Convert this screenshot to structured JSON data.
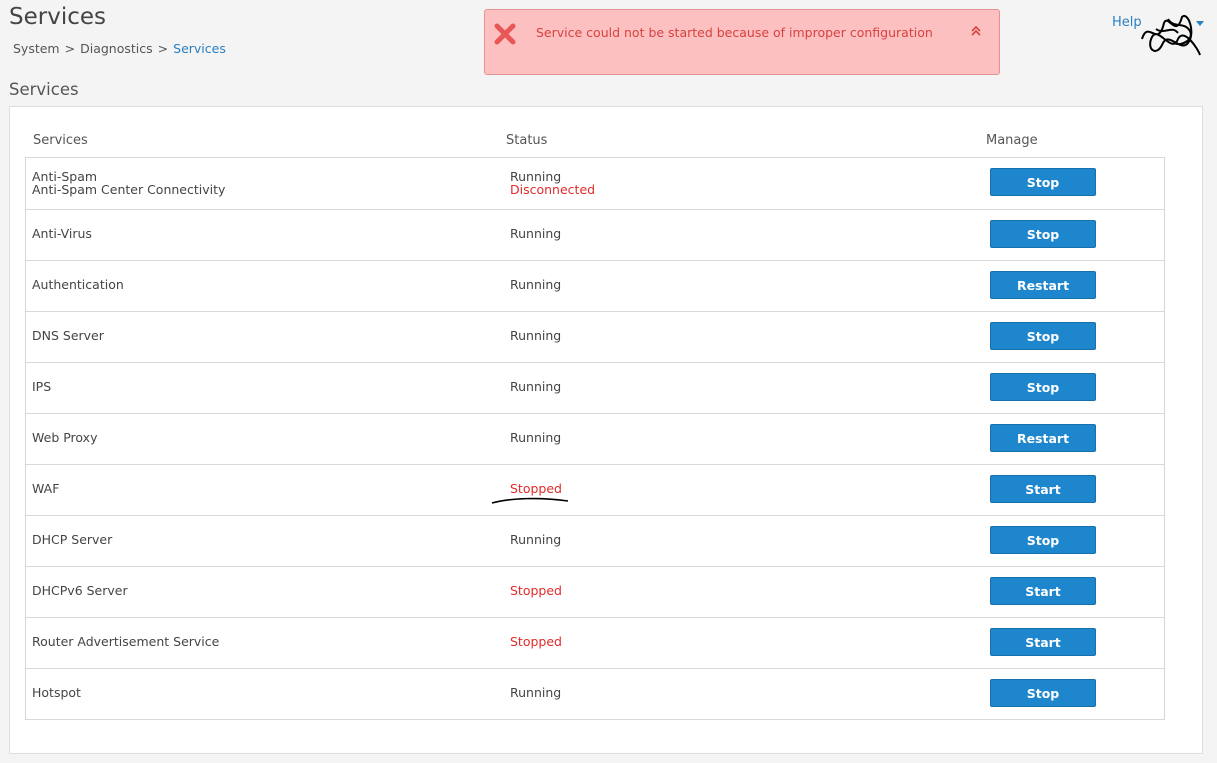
{
  "header": {
    "title": "Services",
    "breadcrumb": [
      "System",
      "Diagnostics",
      "Services"
    ],
    "breadcrumb_sep": ">",
    "help_label": "Help"
  },
  "alert": {
    "message": "Service could not be started because of improper configuration",
    "icon": "error-x-icon",
    "collapse_icon": "double-chevron-up-icon"
  },
  "section": {
    "title": "Services"
  },
  "table": {
    "columns": [
      "Services",
      "Status",
      "Manage"
    ],
    "rows": [
      {
        "name": "Anti-Spam",
        "name_sub": "Anti-Spam Center Connectivity",
        "status": "Running",
        "status_sub": "Disconnected",
        "action": "Stop"
      },
      {
        "name": "Anti-Virus",
        "status": "Running",
        "action": "Stop"
      },
      {
        "name": "Authentication",
        "status": "Running",
        "action": "Restart"
      },
      {
        "name": "DNS Server",
        "status": "Running",
        "action": "Stop"
      },
      {
        "name": "IPS",
        "status": "Running",
        "action": "Stop"
      },
      {
        "name": "Web Proxy",
        "status": "Running",
        "action": "Restart"
      },
      {
        "name": "WAF",
        "status": "Stopped",
        "action": "Start"
      },
      {
        "name": "DHCP Server",
        "status": "Running",
        "action": "Stop"
      },
      {
        "name": "DHCPv6 Server",
        "status": "Stopped",
        "action": "Start"
      },
      {
        "name": "Router Advertisement Service",
        "status": "Stopped",
        "action": "Start"
      },
      {
        "name": "Hotspot",
        "status": "Running",
        "action": "Stop"
      }
    ]
  },
  "colors": {
    "accent": "#1e86cc",
    "link": "#2a7fc1",
    "error": "#e02b2b",
    "alert_bg": "#fcc0c0"
  }
}
